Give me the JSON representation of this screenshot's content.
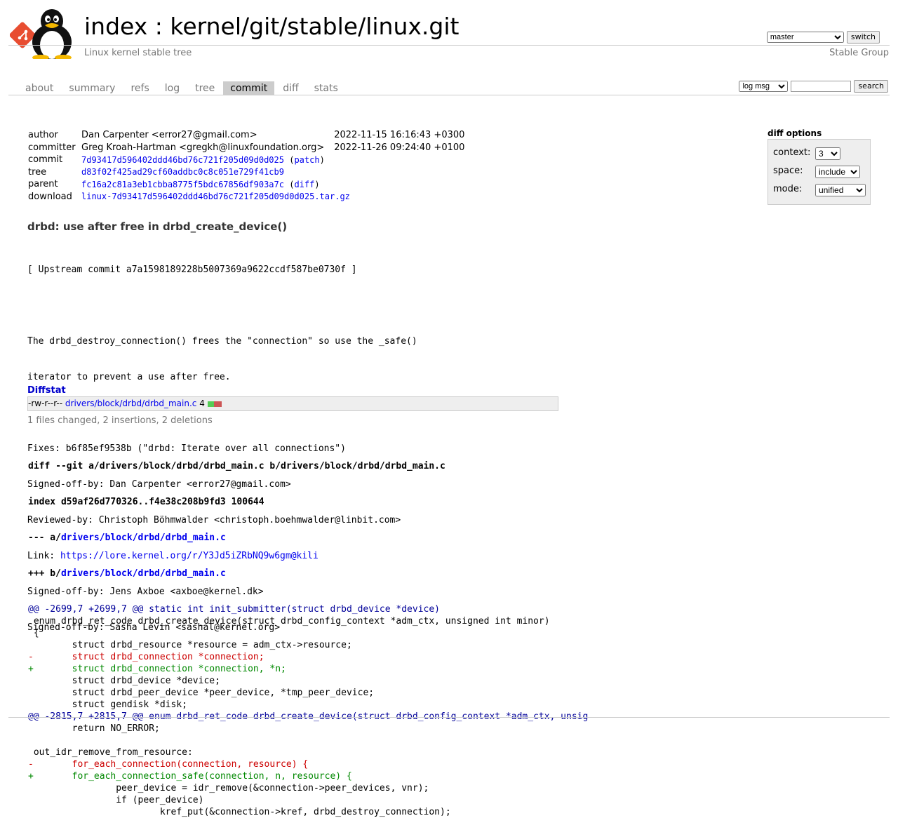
{
  "header": {
    "title_prefix": "index : ",
    "repo": "kernel/git/stable/linux.git",
    "description": "Linux kernel stable tree",
    "owner": "Stable Group",
    "branch": "master",
    "switch_label": "switch"
  },
  "tabs": [
    {
      "label": "about"
    },
    {
      "label": "summary"
    },
    {
      "label": "refs"
    },
    {
      "label": "log"
    },
    {
      "label": "tree"
    },
    {
      "label": "commit"
    },
    {
      "label": "diff"
    },
    {
      "label": "stats"
    }
  ],
  "search": {
    "mode": "log msg",
    "query": "",
    "button": "search"
  },
  "commit_info": {
    "author_label": "author",
    "author": "Dan Carpenter <error27@gmail.com>",
    "author_date": "2022-11-15 16:16:43 +0300",
    "committer_label": "committer",
    "committer": "Greg Kroah-Hartman <gregkh@linuxfoundation.org>",
    "committer_date": "2022-11-26 09:24:40 +0100",
    "commit_label": "commit",
    "commit": "7d93417d596402ddd46bd76c721f205d09d0d025",
    "patch_link": "patch",
    "tree_label": "tree",
    "tree": "d83f02f425ad29cf60addbc0c8c051e729f41cb9",
    "parent_label": "parent",
    "parent": "fc16a2c81a3eb1cbba8775f5bdc67856df903a7c",
    "diff_link": "diff",
    "download_label": "download",
    "download": "linux-7d93417d596402ddd46bd76c721f205d09d0d025.tar.gz"
  },
  "diff_options": {
    "heading": "diff options",
    "context_label": "context:",
    "context": "3",
    "space_label": "space:",
    "space": "include",
    "mode_label": "mode:",
    "mode": "unified"
  },
  "message": {
    "subject": "drbd: use after free in drbd_create_device()",
    "lines": [
      "[ Upstream commit a7a1598189228b5007369a9622ccdf587be0730f ]",
      "",
      "The drbd_destroy_connection() frees the \"connection\" so use the _safe()",
      "iterator to prevent a use after free.",
      "",
      "Fixes: b6f85ef9538b (\"drbd: Iterate over all connections\")",
      "Signed-off-by: Dan Carpenter <error27@gmail.com>",
      "Reviewed-by: Christoph Böhmwalder <christoph.boehmwalder@linbit.com>",
      "Signed-off-by: Jens Axboe <axboe@kernel.dk>",
      "Signed-off-by: Sasha Levin <sashal@kernel.org>"
    ],
    "link_prefix": "Link: ",
    "link_url": "https://lore.kernel.org/r/Y3Jd5iZRbNQ9w6gm@kili"
  },
  "diffstat": {
    "heading": "Diffstat",
    "mode": "-rw-r--r--",
    "file": "drivers/block/drbd/drbd_main.c",
    "count": "4",
    "summary": "1 files changed, 2 insertions, 2 deletions"
  },
  "diff": {
    "header1": "diff --git a/drivers/block/drbd/drbd_main.c b/drivers/block/drbd/drbd_main.c",
    "header2": "index d59af26d770326..f4e38c208b9fd3 100644",
    "minus_prefix": "--- a/",
    "plus_prefix": "+++ b/",
    "path": "drivers/block/drbd/drbd_main.c",
    "lines": [
      {
        "t": "hunk",
        "text": "@@ -2699,7 +2699,7 @@ static int init_submitter(struct drbd_device *device)"
      },
      {
        "t": "ctx",
        "text": " enum drbd_ret_code drbd_create_device(struct drbd_config_context *adm_ctx, unsigned int minor)"
      },
      {
        "t": "ctx",
        "text": " {"
      },
      {
        "t": "ctx",
        "text": " \tstruct drbd_resource *resource = adm_ctx->resource;"
      },
      {
        "t": "del",
        "text": "-\tstruct drbd_connection *connection;"
      },
      {
        "t": "add",
        "text": "+\tstruct drbd_connection *connection, *n;"
      },
      {
        "t": "ctx",
        "text": " \tstruct drbd_device *device;"
      },
      {
        "t": "ctx",
        "text": " \tstruct drbd_peer_device *peer_device, *tmp_peer_device;"
      },
      {
        "t": "ctx",
        "text": " \tstruct gendisk *disk;"
      },
      {
        "t": "hunk",
        "text": "@@ -2815,7 +2815,7 @@ enum drbd_ret_code drbd_create_device(struct drbd_config_context *adm_ctx, unsig"
      },
      {
        "t": "ctx",
        "text": " \treturn NO_ERROR;"
      },
      {
        "t": "ctx",
        "text": " "
      },
      {
        "t": "ctx",
        "text": " out_idr_remove_from_resource:"
      },
      {
        "t": "del",
        "text": "-\tfor_each_connection(connection, resource) {"
      },
      {
        "t": "add",
        "text": "+\tfor_each_connection_safe(connection, n, resource) {"
      },
      {
        "t": "ctx",
        "text": " \t\tpeer_device = idr_remove(&connection->peer_devices, vnr);"
      },
      {
        "t": "ctx",
        "text": " \t\tif (peer_device)"
      },
      {
        "t": "ctx",
        "text": " \t\t\tkref_put(&connection->kref, drbd_destroy_connection);"
      }
    ]
  }
}
